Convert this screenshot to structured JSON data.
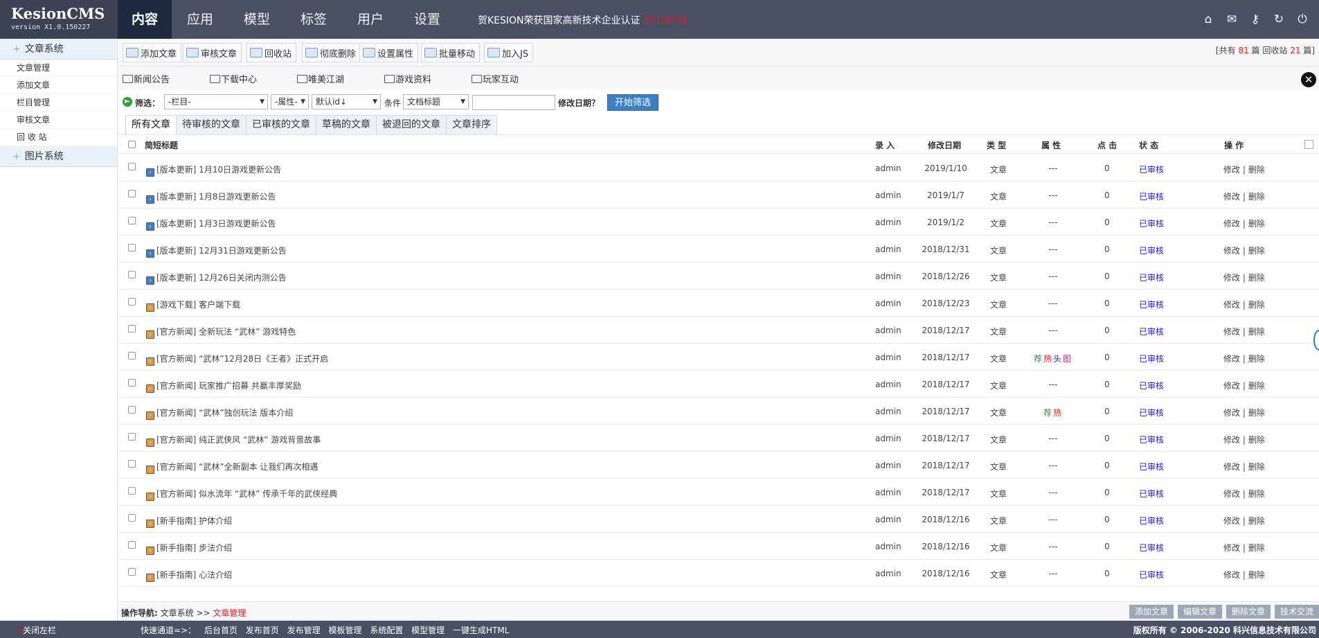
{
  "app": {
    "name": "KesionCMS",
    "version": "version X1.0.150227"
  },
  "nav": {
    "items": [
      "内容",
      "应用",
      "模型",
      "标签",
      "用户",
      "设置"
    ],
    "active": 0
  },
  "congrats": {
    "text": "贺KESION荣获国家高新技术企业认证",
    "date": "2018/2/8"
  },
  "top_icons": [
    "home-icon",
    "mail-icon",
    "key-icon",
    "refresh-icon",
    "power-icon"
  ],
  "sidebar": {
    "groups": [
      {
        "label": "文章系统",
        "items": [
          "文章管理",
          "添加文章",
          "栏目管理",
          "审核文章",
          "回 收 站"
        ]
      },
      {
        "label": "图片系统",
        "items": []
      }
    ]
  },
  "toolbar": {
    "buttons": [
      "添加文章",
      "审核文章",
      "回收站",
      "彻底删除",
      "设置属性",
      "批量移动",
      "加入JS"
    ],
    "stats": {
      "pre": "[共有",
      "total": "81",
      "mid": "篇 回收站",
      "recycle": "21",
      "post": "篇]"
    }
  },
  "categories": [
    "新闻公告",
    "下载中心",
    "唯美江湖",
    "游戏资料",
    "玩家互动"
  ],
  "filter": {
    "label": "筛选：",
    "column": "-栏目-",
    "attr": "-属性-",
    "sort": "默认id↓",
    "cond_label": "条件",
    "cond": "文档标题",
    "date_label": "修改日期？",
    "search_button": "开始筛选"
  },
  "tabs": [
    "所有文章",
    "待审核的文章",
    "已审核的文章",
    "草稿的文章",
    "被退回的文章",
    "文章排序"
  ],
  "table": {
    "headers": {
      "title": "简短标题",
      "author": "录 入",
      "date": "修改日期",
      "type": "类 型",
      "attr": "属 性",
      "hits": "点 击",
      "status": "状 态",
      "ops": "操 作"
    },
    "rows": [
      {
        "icon": "blue",
        "title": "[版本更新] 1月10日游戏更新公告",
        "author": "admin",
        "date": "2019/1/10",
        "type": "文章",
        "attr": "---",
        "hits": "0",
        "status": "已审核"
      },
      {
        "icon": "blue",
        "title": "[版本更新] 1月8日游戏更新公告",
        "author": "admin",
        "date": "2019/1/7",
        "type": "文章",
        "attr": "---",
        "hits": "0",
        "status": "已审核"
      },
      {
        "icon": "blue",
        "title": "[版本更新] 1月3日游戏更新公告",
        "author": "admin",
        "date": "2019/1/2",
        "type": "文章",
        "attr": "---",
        "hits": "0",
        "status": "已审核"
      },
      {
        "icon": "blue",
        "title": "[版本更新] 12月31日游戏更新公告",
        "author": "admin",
        "date": "2018/12/31",
        "type": "文章",
        "attr": "---",
        "hits": "0",
        "status": "已审核"
      },
      {
        "icon": "blue",
        "title": "[版本更新] 12月26日关闭内测公告",
        "author": "admin",
        "date": "2018/12/26",
        "type": "文章",
        "attr": "---",
        "hits": "0",
        "status": "已审核"
      },
      {
        "icon": "orange",
        "title": "[游戏下载] 客户端下载",
        "author": "admin",
        "date": "2018/12/23",
        "type": "文章",
        "attr": "---",
        "hits": "0",
        "status": "已审核"
      },
      {
        "icon": "orange",
        "title": "[官方新闻] 全新玩法 “武林” 游戏特色",
        "author": "admin",
        "date": "2018/12/17",
        "type": "文章",
        "attr": "---",
        "hits": "0",
        "status": "已审核"
      },
      {
        "icon": "orange",
        "title": "[官方新闻] “武林”12月28日《王者》正式开启",
        "author": "admin",
        "date": "2018/12/17",
        "type": "文章",
        "attr": "荐热头图",
        "hits": "0",
        "status": "已审核"
      },
      {
        "icon": "orange",
        "title": "[官方新闻] 玩家推广招募 共赢丰厚奖励",
        "author": "admin",
        "date": "2018/12/17",
        "type": "文章",
        "attr": "---",
        "hits": "0",
        "status": "已审核"
      },
      {
        "icon": "orange",
        "title": "[官方新闻] “武林”独创玩法 版本介绍",
        "author": "admin",
        "date": "2018/12/17",
        "type": "文章",
        "attr": "荐热",
        "hits": "0",
        "status": "已审核"
      },
      {
        "icon": "orange",
        "title": "[官方新闻] 纯正武侠风 “武林” 游戏背景故事",
        "author": "admin",
        "date": "2018/12/17",
        "type": "文章",
        "attr": "---",
        "hits": "0",
        "status": "已审核"
      },
      {
        "icon": "orange",
        "title": "[官方新闻] “武林”全新副本 让我们再次相遇",
        "author": "admin",
        "date": "2018/12/17",
        "type": "文章",
        "attr": "---",
        "hits": "0",
        "status": "已审核"
      },
      {
        "icon": "orange",
        "title": "[官方新闻] 似水流年 “武林” 传承千年的武侠经典",
        "author": "admin",
        "date": "2018/12/17",
        "type": "文章",
        "attr": "---",
        "hits": "0",
        "status": "已审核"
      },
      {
        "icon": "orange",
        "title": "[新手指南] 护体介绍",
        "author": "admin",
        "date": "2018/12/16",
        "type": "文章",
        "attr": "---",
        "hits": "0",
        "status": "已审核"
      },
      {
        "icon": "orange",
        "title": "[新手指南] 步法介绍",
        "author": "admin",
        "date": "2018/12/16",
        "type": "文章",
        "attr": "---",
        "hits": "0",
        "status": "已审核"
      },
      {
        "icon": "orange",
        "title": "[新手指南] 心法介绍",
        "author": "admin",
        "date": "2018/12/16",
        "type": "文章",
        "attr": "---",
        "hits": "0",
        "status": "已审核"
      }
    ],
    "op_edit": "修改",
    "op_sep": "|",
    "op_delete": "删除"
  },
  "attr_colors": {
    "荐": "#2a8a2a",
    "热": "#e8181d",
    "头": "#1a1ad6",
    "图": "#b0308f"
  },
  "breadcrumb": {
    "label": "操作导航:",
    "parent": "文章系统",
    "sep": ">>",
    "current": "文章管理"
  },
  "bottom_buttons": [
    "添加文章",
    "编辑文章",
    "删除文章",
    "技术交流"
  ],
  "footer": {
    "close_left": "关闭左栏",
    "quick_label": "快速通道=>：",
    "links": [
      "后台首页",
      "发布首页",
      "发布管理",
      "模板管理",
      "系统配置",
      "模型管理",
      "一键生成HTML"
    ],
    "copyright": "版权所有 © 2006-2020 科兴信息技术有限公司"
  }
}
